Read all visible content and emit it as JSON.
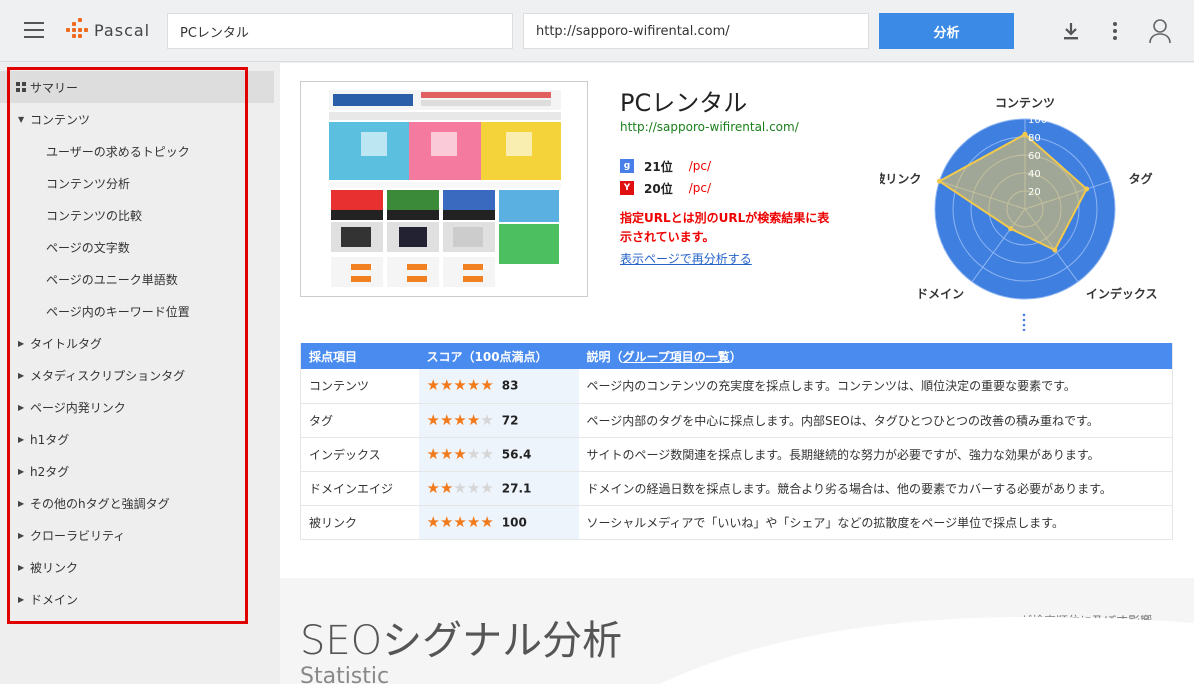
{
  "topbar": {
    "logo_text": "Pascal",
    "keyword_value": "PCレンタル",
    "url_value": "http://sapporo-wifirental.com/",
    "analyze_label": "分析"
  },
  "sidebar": {
    "items": [
      {
        "label": "サマリー"
      },
      {
        "label": "コンテンツ"
      },
      {
        "label": "ユーザーの求めるトピック"
      },
      {
        "label": "コンテンツ分析"
      },
      {
        "label": "コンテンツの比較"
      },
      {
        "label": "ページの文字数"
      },
      {
        "label": "ページのユニーク単語数"
      },
      {
        "label": "ページ内のキーワード位置"
      },
      {
        "label": "タイトルタグ"
      },
      {
        "label": "メタディスクリプションタグ"
      },
      {
        "label": "ページ内発リンク"
      },
      {
        "label": "h1タグ"
      },
      {
        "label": "h2タグ"
      },
      {
        "label": "その他のhタグと強調タグ"
      },
      {
        "label": "クローラビリティ"
      },
      {
        "label": "被リンク"
      },
      {
        "label": "ドメイン"
      }
    ]
  },
  "summary": {
    "title": "PCレンタル",
    "url": "http://sapporo-wifirental.com/",
    "google_badge": "g",
    "yahoo_badge": "Y",
    "google_rank": "21位",
    "google_path": "/pc/",
    "yahoo_rank": "20位",
    "yahoo_path": "/pc/",
    "warning": "指定URLとは別のURLが検索結果に表示されています。",
    "reanalyze_link": "表示ページで再分析する"
  },
  "radar": {
    "labels": [
      "コンテンツ",
      "タグ",
      "インデックス",
      "ドメイン",
      "被リンク"
    ],
    "values": [
      83,
      72,
      56.4,
      27.1,
      100
    ],
    "ticks": [
      "20",
      "40",
      "60",
      "80",
      "100"
    ],
    "max": 100
  },
  "score_table": {
    "headers": {
      "item": "採点項目",
      "score": "スコア（100点満点）",
      "desc_prefix": "説明（",
      "desc_link": "グループ項目の一覧",
      "desc_suffix": "）"
    },
    "rows": [
      {
        "item": "コンテンツ",
        "score": 83,
        "score_text": "83",
        "stars": 5,
        "desc": "ページ内のコンテンツの充実度を採点します。コンテンツは、順位決定の重要な要素です。"
      },
      {
        "item": "タグ",
        "score": 72,
        "score_text": "72",
        "stars": 4,
        "desc": "ページ内部のタグを中心に採点します。内部SEOは、タグひとつひとつの改善の積み重ねです。"
      },
      {
        "item": "インデックス",
        "score": 56.4,
        "score_text": "56.4",
        "stars": 3,
        "desc": "サイトのページ数関連を採点します。長期継続的な努力が必要ですが、強力な効果があります。"
      },
      {
        "item": "ドメインエイジ",
        "score": 27.1,
        "score_text": "27.1",
        "stars": 2,
        "desc": "ドメインの経過日数を採点します。競合より劣る場合は、他の要素でカバーする必要があります。"
      },
      {
        "item": "被リンク",
        "score": 100,
        "score_text": "100",
        "stars": 5,
        "desc": "ソーシャルメディアで「いいね」や「シェア」などの拡散度をページ単位で採点します。"
      }
    ]
  },
  "bottom": {
    "title": "SEOシグナル分析",
    "subtitle": "Statistic",
    "right_text": "が検索順位に及ぼす影響"
  },
  "colors": {
    "accent": "#3b8be6",
    "highlight": "#e00000",
    "star": "#f27a1a",
    "radar_fill": "#3f7fe0"
  }
}
